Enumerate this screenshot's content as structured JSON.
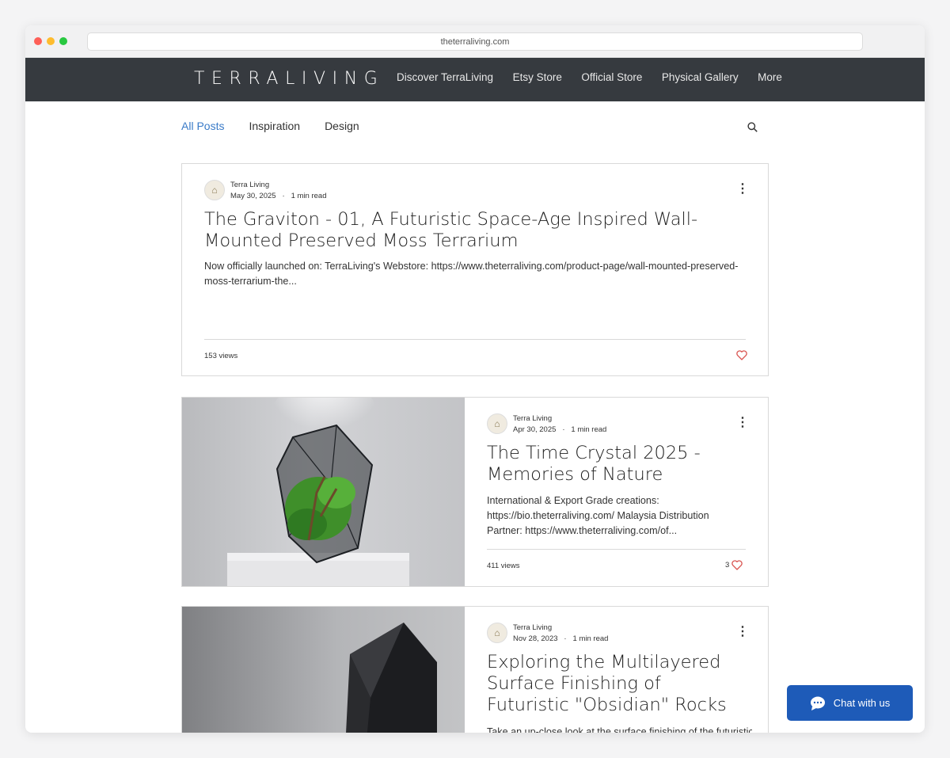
{
  "browser": {
    "url": "theterraliving.com"
  },
  "site": {
    "logo": "TERRALIVING",
    "nav": [
      "Discover TerraLiving",
      "Etsy Store",
      "Official Store",
      "Physical Gallery",
      "More"
    ]
  },
  "blog": {
    "categories": [
      "All Posts",
      "Inspiration",
      "Design"
    ],
    "active_category": "All Posts",
    "posts": [
      {
        "author": "Terra Living",
        "date": "May 30, 2025",
        "read_time": "1 min read",
        "title": "The Graviton - 01, A Futuristic Space-Age Inspired Wall-Mounted Preserved Moss Terrarium",
        "excerpt": "Now officially launched on: TerraLiving's Webstore: https://www.theterraliving.com/product-page/wall-mounted-preserved-moss-terrarium-the...",
        "views": "153 views",
        "likes": ""
      },
      {
        "author": "Terra Living",
        "date": "Apr 30, 2025",
        "read_time": "1 min read",
        "title": "The Time Crystal 2025 - Memories of Nature",
        "excerpt": "International & Export Grade creations: https://bio.theterraliving.com/ Malaysia Distribution Partner: https://www.theterraliving.com/of...",
        "views": "411 views",
        "likes": "3"
      },
      {
        "author": "Terra Living",
        "date": "Nov 28, 2023",
        "read_time": "1 min read",
        "title": "Exploring the Multilayered Surface Finishing of Futuristic \"Obsidian\" Rocks",
        "excerpt": "Take an up-close look at the surface finishing of the futuristic",
        "views": "",
        "likes": ""
      }
    ]
  },
  "chat": {
    "label": "Chat with us"
  },
  "colors": {
    "nav_bg": "#363a3f",
    "accent": "#3a7bc8",
    "heart": "#d9534f",
    "chat_bg": "#1e5bb8"
  }
}
